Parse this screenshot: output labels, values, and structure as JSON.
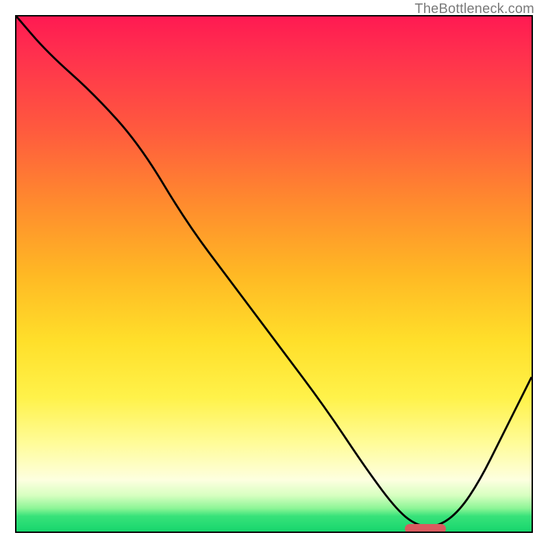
{
  "watermark": "TheBottleneck.com",
  "chart_data": {
    "type": "line",
    "title": "",
    "xlabel": "",
    "ylabel": "",
    "xlim": [
      0,
      100
    ],
    "ylim": [
      0,
      100
    ],
    "grid": false,
    "legend": false,
    "gradient_stops": [
      {
        "pct": 0,
        "color": "#ff1a52"
      },
      {
        "pct": 22,
        "color": "#ff5a3e"
      },
      {
        "pct": 50,
        "color": "#ffb824"
      },
      {
        "pct": 74,
        "color": "#fff24a"
      },
      {
        "pct": 90,
        "color": "#fdffe0"
      },
      {
        "pct": 97,
        "color": "#17d66d"
      },
      {
        "pct": 100,
        "color": "#17d66d"
      }
    ],
    "series": [
      {
        "name": "bottleneck-curve",
        "x": [
          0,
          6,
          15,
          24,
          33,
          42,
          51,
          60,
          68,
          74,
          78,
          82,
          86,
          90,
          94,
          100
        ],
        "y": [
          100,
          93,
          85,
          75,
          60,
          48,
          36,
          24,
          12,
          4,
          1,
          1,
          4,
          10,
          18,
          30
        ]
      }
    ],
    "marker": {
      "name": "optimal-range",
      "x_start": 75,
      "x_end": 83,
      "y": 1,
      "color": "#d95b5f"
    }
  }
}
